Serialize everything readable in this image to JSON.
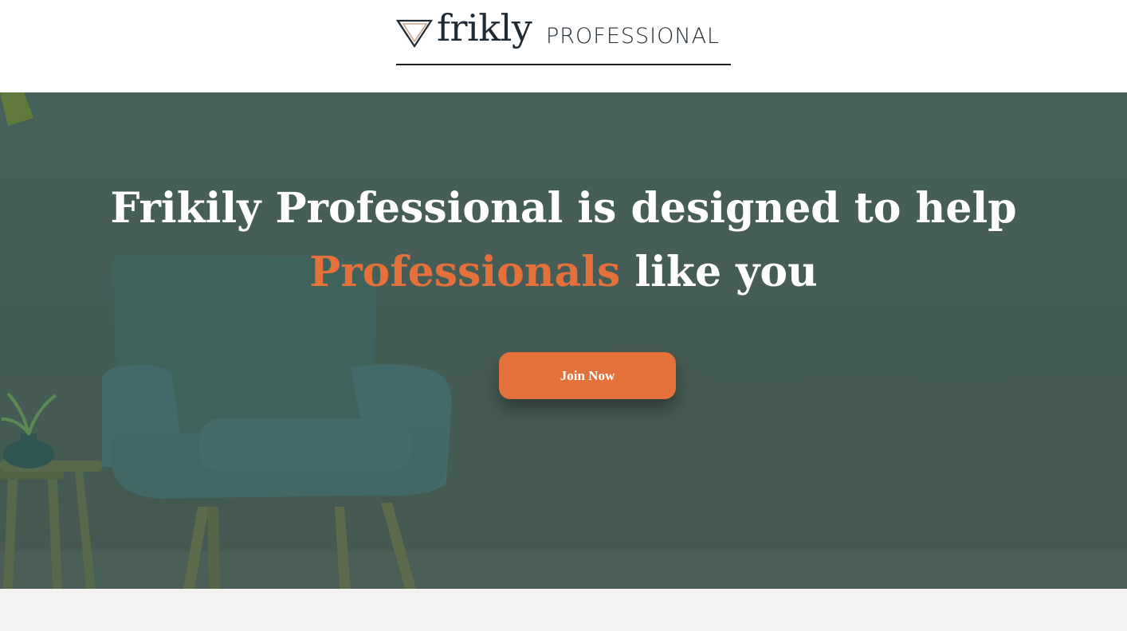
{
  "header": {
    "logo_word": "frikly",
    "logo_suffix": "PROFESSIONAL"
  },
  "hero": {
    "headline_line1": "Frikily Professional is designed to help",
    "headline_accent": "Professionals",
    "headline_rest": " like you",
    "cta_label": "Join Now"
  },
  "colors": {
    "accent": "#e4703a",
    "hero_overlay": "#465e55",
    "text_dark": "#1f2a33",
    "footer_band": "#f4f1f1"
  }
}
